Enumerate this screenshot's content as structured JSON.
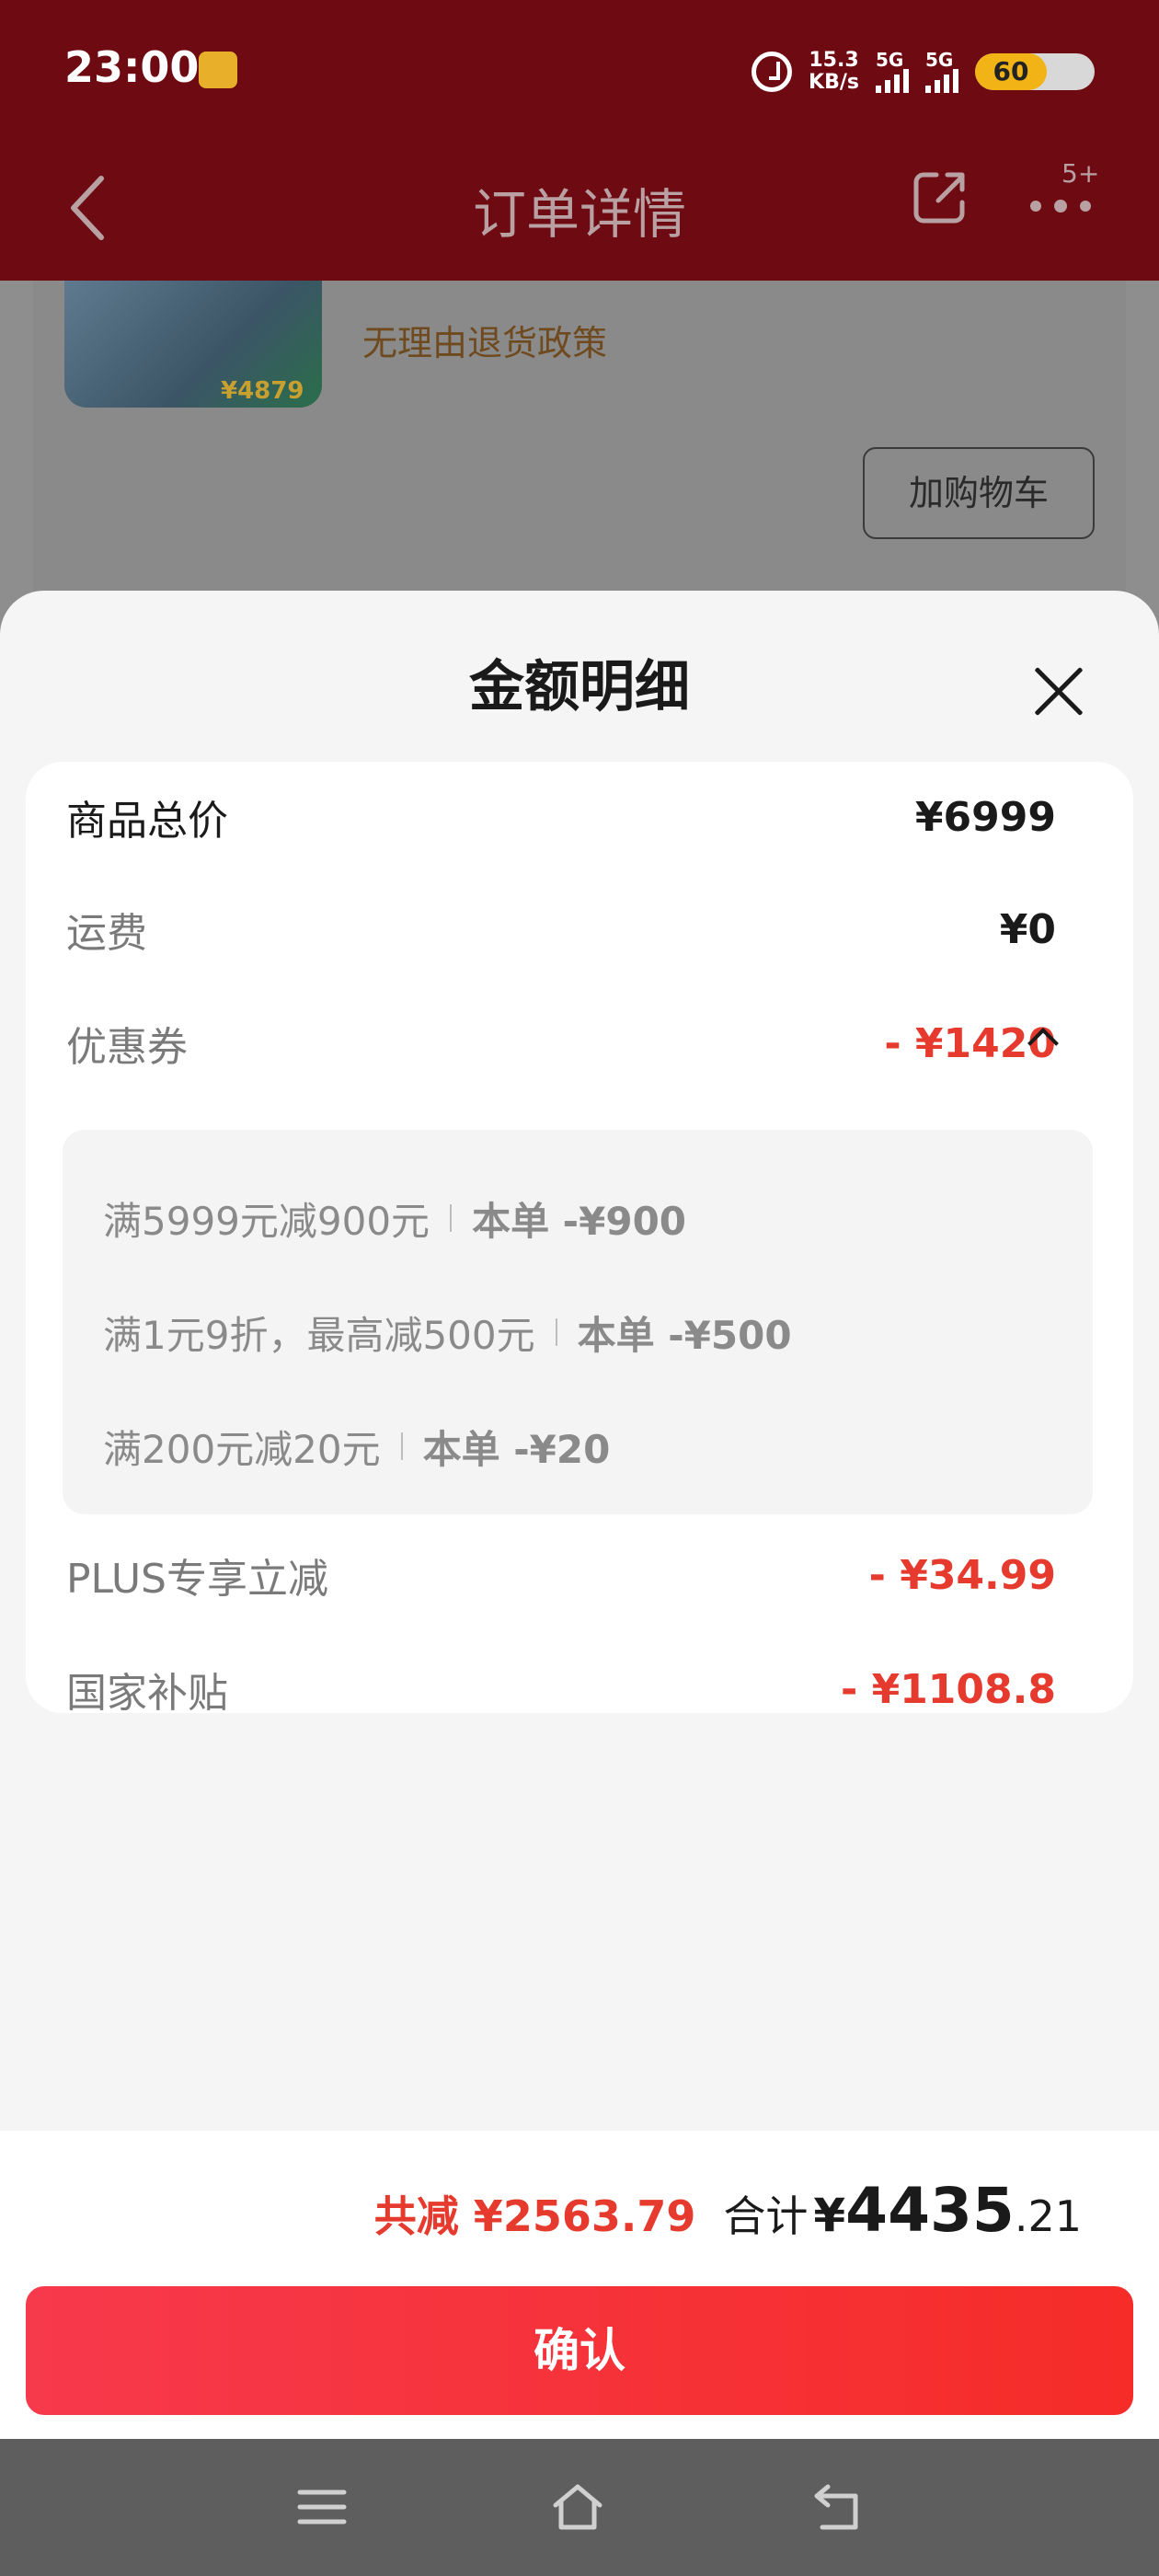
{
  "status_bar": {
    "time": "23:00",
    "net_speed_value": "15.3",
    "net_speed_unit": "KB/s",
    "signal1_label": "5G",
    "signal2_label": "5G",
    "battery": "60",
    "battery_level": 0.6
  },
  "nav": {
    "title": "订单详情",
    "badge": "5+"
  },
  "background_order": {
    "thumb_price": "¥4879",
    "policy_text": "无理由退货政策",
    "add_to_cart": "加购物车"
  },
  "sheet": {
    "title": "金额明细",
    "rows": {
      "goods_total": {
        "label": "商品总价",
        "value": "¥6999"
      },
      "shipping": {
        "label": "运费",
        "value": "¥0"
      },
      "coupon": {
        "label": "优惠券",
        "value": "- ¥1420"
      },
      "plus": {
        "label": "PLUS专享立减",
        "value": "- ¥34.99"
      },
      "subsidy": {
        "label": "国家补贴",
        "value": "- ¥1108.8"
      }
    },
    "coupons": [
      {
        "rule": "满5999元减900元",
        "amount": "本单 -¥900"
      },
      {
        "rule": "满1元9折，最高减500元",
        "amount": "本单 -¥500"
      },
      {
        "rule": "满200元减20元",
        "amount": "本单 -¥20"
      }
    ]
  },
  "summary": {
    "saved": "共减 ¥2563.79",
    "total_label": "合计",
    "total_symbol": "¥",
    "total_int": "4435",
    "total_dec": ".21"
  },
  "confirm_label": "确认",
  "colors": {
    "accent_red": "#e53a2d",
    "button_red": "#f52c28",
    "header_red": "#6e0b12"
  }
}
